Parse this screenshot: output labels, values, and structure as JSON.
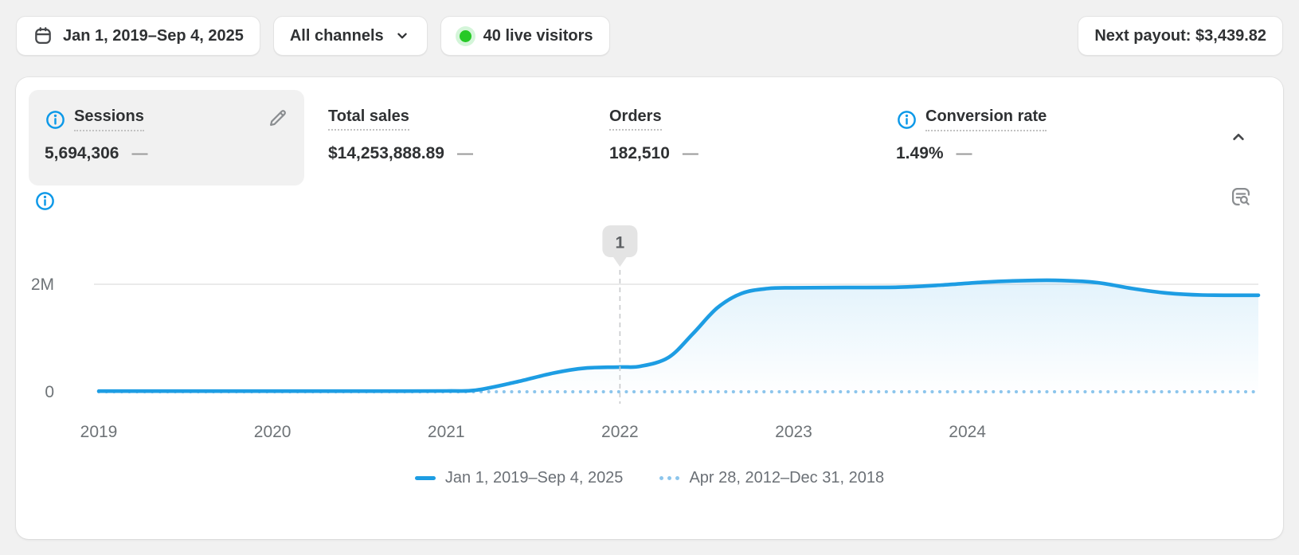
{
  "topbar": {
    "date_range": "Jan 1, 2019–Sep 4, 2025",
    "channels": "All channels",
    "live_visitors": "40 live visitors",
    "next_payout": "Next payout: $3,439.82"
  },
  "metrics": [
    {
      "label": "Sessions",
      "value": "5,694,306",
      "delta": "—",
      "selected": true
    },
    {
      "label": "Total sales",
      "value": "$14,253,888.89",
      "delta": "—",
      "selected": false
    },
    {
      "label": "Orders",
      "value": "182,510",
      "delta": "—",
      "selected": false
    },
    {
      "label": "Conversion rate",
      "value": "1.49%",
      "delta": "—",
      "selected": false
    }
  ],
  "legend": [
    {
      "label": "Jan 1, 2019–Sep 4, 2025",
      "swatch": "solid",
      "color": "#1d9de3"
    },
    {
      "label": "Apr 28, 2012–Dec 31, 2018",
      "swatch": "dotted",
      "color": "#8cc5ec"
    }
  ],
  "icons": {
    "calendar": "calendar-icon",
    "chevron_down": "chevron-down-icon",
    "live_dot": "live-dot-icon",
    "info": "info-icon",
    "edit": "edit-pencil-icon",
    "chevron_up": "chevron-up-icon",
    "explore": "search-report-icon"
  },
  "colors": {
    "accent": "#1d9de3",
    "comparison": "#8cc5ec",
    "green_dot": "#26c926",
    "page_bg": "#f1f1f1",
    "card_bg": "#ffffff",
    "text": "#303030",
    "muted_text": "#6e7377",
    "grid": "#e4e4e4",
    "badge_bg": "#e4e4e4"
  },
  "chart_data": {
    "type": "area",
    "ylabel": "Sessions",
    "x_domain": [
      2019.0,
      2025.675
    ],
    "ylim": [
      0,
      2800000
    ],
    "grid": "horizontal, 2M line only",
    "legend_position": "bottom-center",
    "x_ticks": [
      {
        "value": 2019,
        "label": "2019"
      },
      {
        "value": 2020,
        "label": "2020"
      },
      {
        "value": 2021,
        "label": "2021"
      },
      {
        "value": 2022,
        "label": "2022"
      },
      {
        "value": 2023,
        "label": "2023"
      },
      {
        "value": 2024,
        "label": "2024"
      }
    ],
    "y_ticks": [
      {
        "value": 0,
        "label": "0"
      },
      {
        "value": 2000000,
        "label": "2M"
      }
    ],
    "annotations": [
      {
        "label": "1",
        "x": 2022.0
      }
    ],
    "series": [
      {
        "name": "Jan 1, 2019–Sep 4, 2025",
        "style": "solid",
        "color": "#1d9de3",
        "points": [
          [
            2019.0,
            12000
          ],
          [
            2019.5,
            12000
          ],
          [
            2020.0,
            12000
          ],
          [
            2020.5,
            12000
          ],
          [
            2021.0,
            15000
          ],
          [
            2021.17,
            30000
          ],
          [
            2021.4,
            180000
          ],
          [
            2021.62,
            350000
          ],
          [
            2021.8,
            440000
          ],
          [
            2022.0,
            460000
          ],
          [
            2022.12,
            475000
          ],
          [
            2022.28,
            640000
          ],
          [
            2022.42,
            1080000
          ],
          [
            2022.56,
            1560000
          ],
          [
            2022.7,
            1830000
          ],
          [
            2022.85,
            1920000
          ],
          [
            2023.0,
            1935000
          ],
          [
            2023.3,
            1940000
          ],
          [
            2023.6,
            1945000
          ],
          [
            2023.85,
            1985000
          ],
          [
            2024.1,
            2040000
          ],
          [
            2024.35,
            2070000
          ],
          [
            2024.55,
            2070000
          ],
          [
            2024.75,
            2030000
          ],
          [
            2024.95,
            1920000
          ],
          [
            2025.15,
            1835000
          ],
          [
            2025.35,
            1800000
          ],
          [
            2025.675,
            1795000
          ]
        ]
      },
      {
        "name": "Apr 28, 2012–Dec 31, 2018",
        "style": "dotted",
        "color": "#8cc5ec",
        "points": [
          [
            2019.0,
            0
          ],
          [
            2025.675,
            0
          ]
        ]
      }
    ]
  }
}
